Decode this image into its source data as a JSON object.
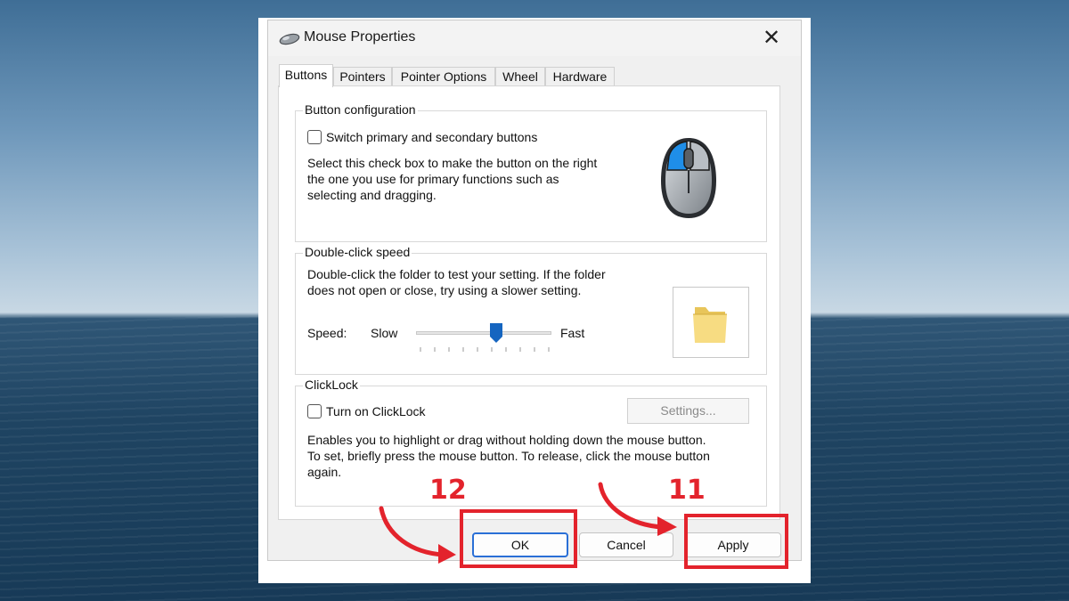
{
  "window": {
    "title": "Mouse Properties",
    "close_glyph": "✕"
  },
  "tabs": [
    {
      "label": "Buttons",
      "active": true
    },
    {
      "label": "Pointers",
      "active": false
    },
    {
      "label": "Pointer Options",
      "active": false
    },
    {
      "label": "Wheel",
      "active": false
    },
    {
      "label": "Hardware",
      "active": false
    }
  ],
  "button_config": {
    "label": "Button configuration",
    "checkbox_label": "Switch primary and secondary buttons",
    "checked": false,
    "description_lines": [
      "Select this check box to make the button on the right",
      "the one you use for primary functions such as",
      "selecting and dragging."
    ]
  },
  "double_click": {
    "label": "Double-click speed",
    "description_lines": [
      "Double-click the folder to test your setting. If the folder",
      "does not open or close, try using a slower setting."
    ],
    "speed_label": "Speed:",
    "slow_label": "Slow",
    "fast_label": "Fast",
    "speed_value": 0.6
  },
  "clicklock": {
    "label": "ClickLock",
    "checkbox_label": "Turn on ClickLock",
    "checked": false,
    "settings_label": "Settings...",
    "description_lines": [
      "Enables you to highlight or drag without holding down the mouse button.",
      "To set, briefly press the mouse button. To release, click the mouse button",
      "again."
    ]
  },
  "buttons": {
    "ok": "OK",
    "cancel": "Cancel",
    "apply": "Apply"
  },
  "annotations": {
    "ok_step": "12",
    "apply_step": "11",
    "accent_color": "#e3232c"
  }
}
